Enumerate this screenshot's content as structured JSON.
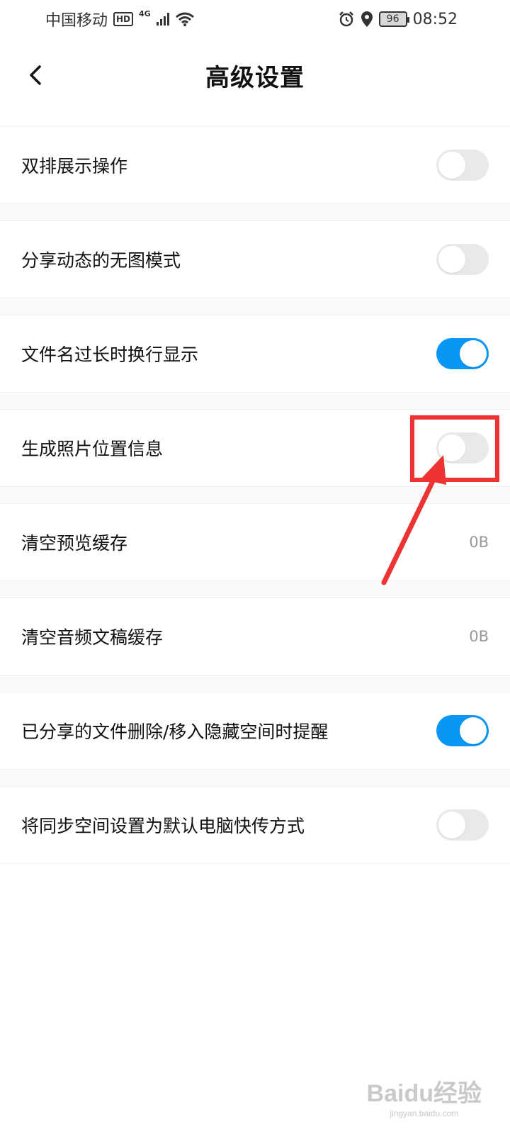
{
  "status_bar": {
    "carrier": "中国移动",
    "hd": "HD",
    "network": "4G",
    "battery": "96",
    "time": "08:52"
  },
  "header": {
    "title": "高级设置"
  },
  "settings": [
    {
      "label": "双排展示操作",
      "type": "toggle",
      "on": false
    },
    {
      "label": "分享动态的无图模式",
      "type": "toggle",
      "on": false
    },
    {
      "label": "文件名过长时换行显示",
      "type": "toggle",
      "on": true
    },
    {
      "label": "生成照片位置信息",
      "type": "toggle",
      "on": false
    },
    {
      "label": "清空预览缓存",
      "type": "value",
      "value": "0B"
    },
    {
      "label": "清空音频文稿缓存",
      "type": "value",
      "value": "0B"
    },
    {
      "label": "已分享的文件删除/移入隐藏空间时提醒",
      "type": "toggle",
      "on": true
    },
    {
      "label": "将同步空间设置为默认电脑快传方式",
      "type": "toggle",
      "on": false
    }
  ],
  "colors": {
    "toggle_on": "#0a96f4",
    "toggle_off": "#e9e9e9",
    "annotation": "#ee3333"
  },
  "watermark": {
    "brand": "Baidu经验",
    "url": "jingyan.baidu.com"
  }
}
